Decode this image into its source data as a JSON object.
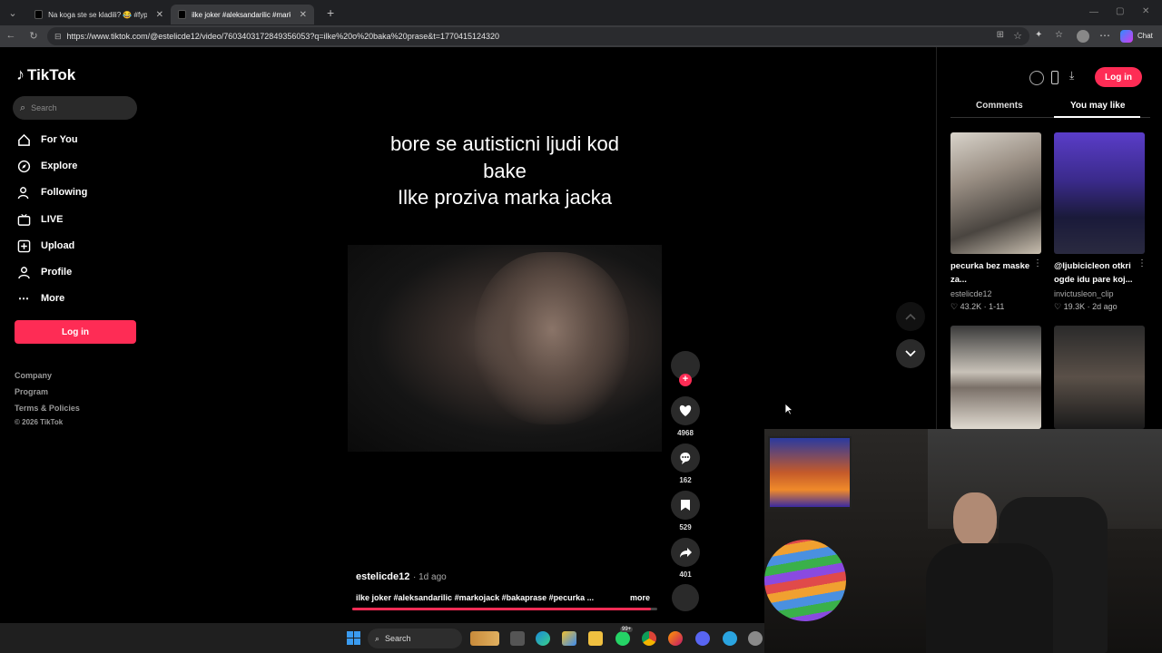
{
  "browser": {
    "tabs": [
      {
        "title": "Na koga ste se kladili? 😂 #fyp #g"
      },
      {
        "title": "ilke joker #aleksandarilic #markoj"
      }
    ],
    "new_tab": "+",
    "url": "https://www.tiktok.com/@estelicde12/video/7603403172849356053?q=ilke%20o%20baka%20prase&t=1770415124320",
    "chat_label": "Chat"
  },
  "sidebar": {
    "logo": "TikTok",
    "search_placeholder": "Search",
    "nav": [
      {
        "label": "For You"
      },
      {
        "label": "Explore"
      },
      {
        "label": "Following"
      },
      {
        "label": "LIVE"
      },
      {
        "label": "Upload"
      },
      {
        "label": "Profile"
      },
      {
        "label": "More"
      }
    ],
    "login": "Log in",
    "footer": [
      "Company",
      "Program",
      "Terms & Policies",
      "© 2026 TikTok"
    ]
  },
  "video": {
    "caption_lines": [
      "bore se autisticni ljudi kod",
      "bake",
      "Ilke proziva marka jacka"
    ],
    "author": "estelicde12",
    "age": "· 1d ago",
    "description": "ilke joker #aleksandarilic #markojack #bakaprase #pecurka ...",
    "more": "more",
    "progress": 0.98
  },
  "actions": {
    "likes": "4968",
    "comments": "162",
    "saves": "529",
    "shares": "401"
  },
  "right": {
    "login": "Log in",
    "tabs": [
      "Comments",
      "You may like"
    ],
    "active_tab": "You may like",
    "recommendations": [
      {
        "title": "pecurka bez maske za...",
        "user": "estelicde12",
        "stats": "♡ 43.2K · 1-11"
      },
      {
        "title": "@ljubicicleon otkri ogde idu pare koj...",
        "user": "invictusleon_clip",
        "stats": "♡ 19.3K · 2d ago"
      }
    ]
  },
  "taskbar": {
    "search": "Search",
    "badge": "99+"
  },
  "colors": {
    "accent": "#fe2c55",
    "background": "#000000",
    "panel": "#2a2a2a"
  }
}
